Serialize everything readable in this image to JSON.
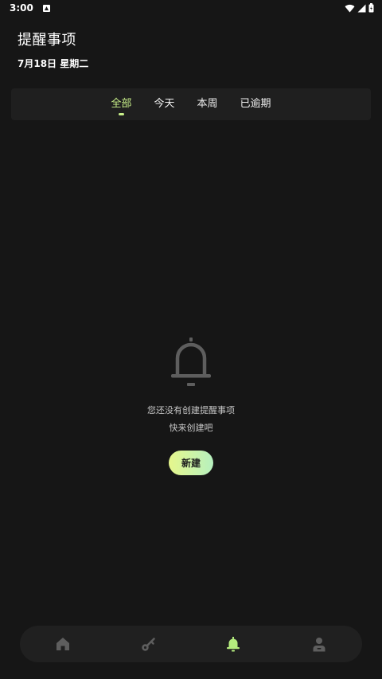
{
  "status_bar": {
    "time": "3:00"
  },
  "header": {
    "title": "提醒事项",
    "date": "7月18日 星期二"
  },
  "tabs": [
    {
      "label": "全部",
      "active": true
    },
    {
      "label": "今天",
      "active": false
    },
    {
      "label": "本周",
      "active": false
    },
    {
      "label": "已逾期",
      "active": false
    }
  ],
  "empty_state": {
    "icon": "bell-icon",
    "message_line1": "您还没有创建提醒事项",
    "message_line2": "快来创建吧",
    "button_label": "新建"
  },
  "bottom_nav": {
    "items": [
      {
        "icon": "home-icon",
        "active": false
      },
      {
        "icon": "key-icon",
        "active": false
      },
      {
        "icon": "bell-icon",
        "active": true
      },
      {
        "icon": "profile-icon",
        "active": false
      }
    ]
  },
  "colors": {
    "background": "#161616",
    "surface": "#1f1f1f",
    "accent": "#c9f08a",
    "button_gradient_start": "#e6f78c",
    "button_gradient_end": "#b6f0bf",
    "inactive_icon": "#5e5e5e"
  }
}
